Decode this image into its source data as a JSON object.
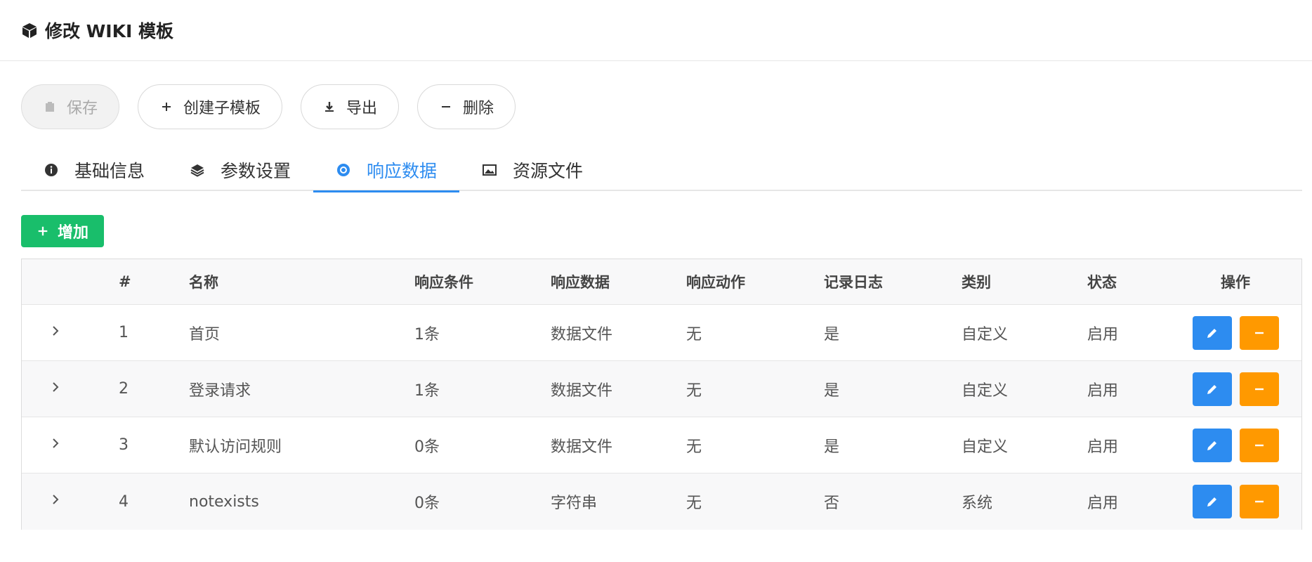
{
  "header": {
    "title": "修改 WIKI 模板",
    "icon": "cube-icon"
  },
  "toolbar": {
    "save_label": "保存",
    "create_child_label": "创建子模板",
    "export_label": "导出",
    "delete_label": "删除"
  },
  "tabs": [
    {
      "label": "基础信息",
      "icon": "info-icon"
    },
    {
      "label": "参数设置",
      "icon": "layers-icon"
    },
    {
      "label": "响应数据",
      "icon": "at-icon",
      "active": true
    },
    {
      "label": "资源文件",
      "icon": "image-icon"
    }
  ],
  "add_button": {
    "label": "增加"
  },
  "table": {
    "headers": {
      "idx": "#",
      "name": "名称",
      "cond": "响应条件",
      "data": "响应数据",
      "act": "响应动作",
      "log": "记录日志",
      "type": "类别",
      "status": "状态",
      "ops": "操作"
    },
    "rows": [
      {
        "idx": "1",
        "name": "首页",
        "cond": "1条",
        "data": "数据文件",
        "act": "无",
        "log": "是",
        "type": "自定义",
        "status": "启用"
      },
      {
        "idx": "2",
        "name": "登录请求",
        "cond": "1条",
        "data": "数据文件",
        "act": "无",
        "log": "是",
        "type": "自定义",
        "status": "启用"
      },
      {
        "idx": "3",
        "name": "默认访问规则",
        "cond": "0条",
        "data": "数据文件",
        "act": "无",
        "log": "是",
        "type": "自定义",
        "status": "启用"
      },
      {
        "idx": "4",
        "name": "notexists",
        "cond": "0条",
        "data": "字符串",
        "act": "无",
        "log": "否",
        "type": "系统",
        "status": "启用"
      }
    ]
  },
  "colors": {
    "primary": "#2d8cf0",
    "success": "#19be6b",
    "warning": "#ff9900"
  }
}
